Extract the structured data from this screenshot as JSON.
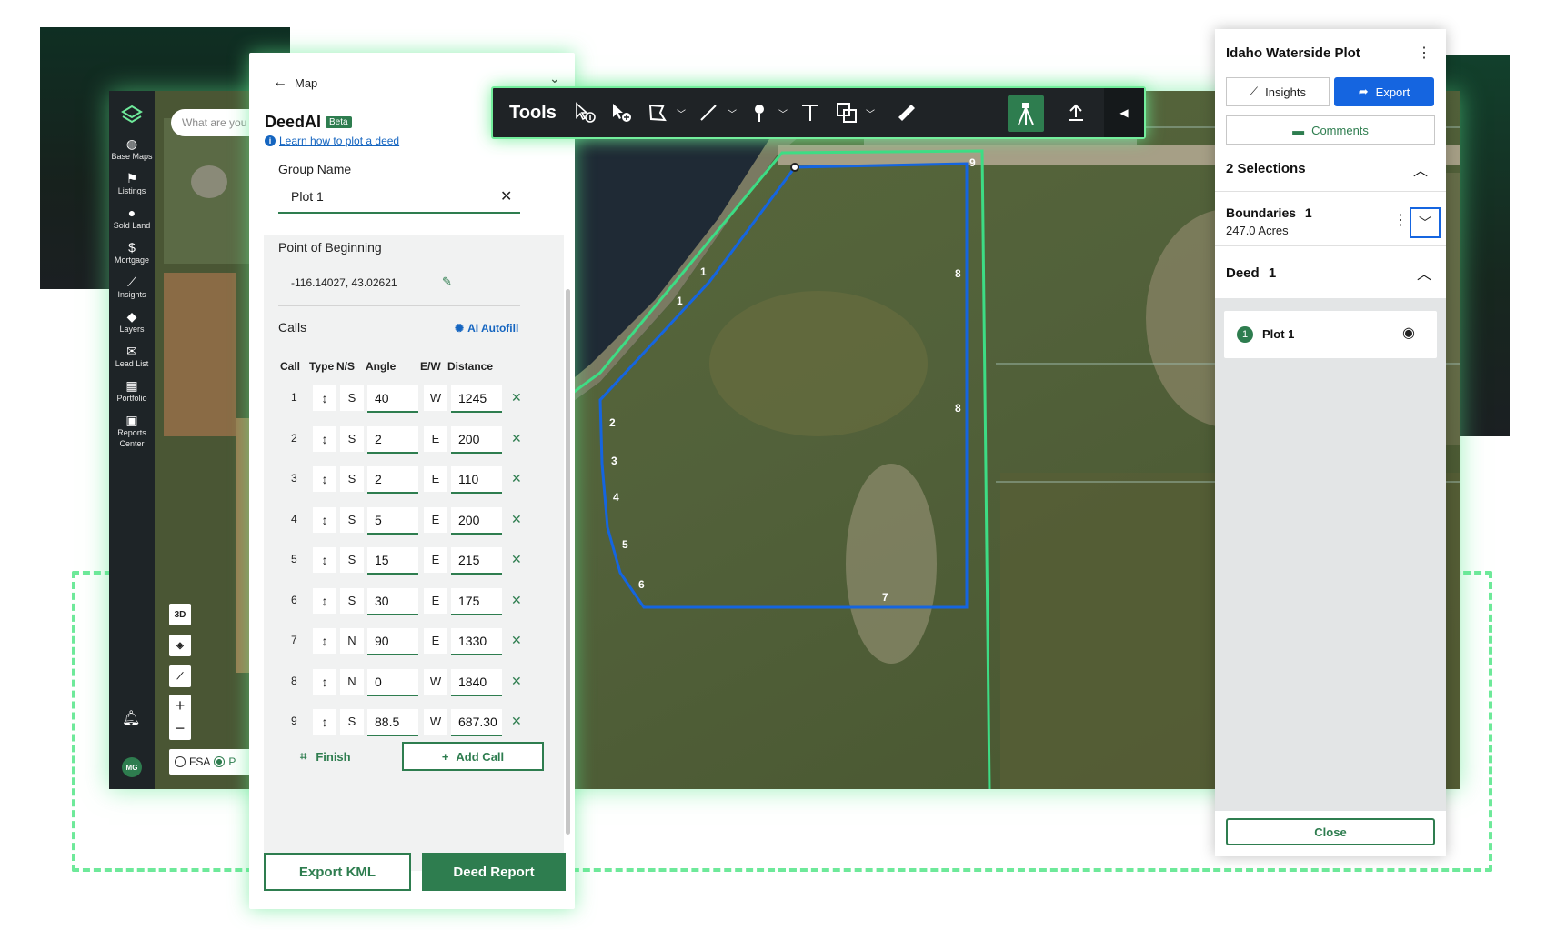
{
  "sidebar": {
    "items": [
      {
        "label": "Base Maps",
        "icon": "globe-icon"
      },
      {
        "label": "Listings",
        "icon": "flag-icon"
      },
      {
        "label": "Sold Land",
        "icon": "pin-icon"
      },
      {
        "label": "Mortgage",
        "icon": "dollar-icon"
      },
      {
        "label": "Insights",
        "icon": "insights-icon"
      },
      {
        "label": "Layers",
        "icon": "layers-icon"
      },
      {
        "label": "Lead List",
        "icon": "mail-icon"
      },
      {
        "label": "Portfolio",
        "icon": "map-icon"
      },
      {
        "label": "Reports Center",
        "icon": "briefcase-icon"
      }
    ],
    "avatar": "MG"
  },
  "search": {
    "placeholder": "What are you"
  },
  "map_controls": {
    "three_d": "3D",
    "zoom_in": "+",
    "zoom_out": "−",
    "fsa": "FSA",
    "second_option": "P"
  },
  "deed_panel": {
    "back_label": "Map",
    "title": "DeedAI",
    "badge": "Beta",
    "learn_link": "Learn how to plot a deed",
    "group_name_label": "Group Name",
    "group_name_value": "Plot 1",
    "pob_label": "Point of Beginning",
    "pob_value": "-116.14027, 43.02621",
    "calls_label": "Calls",
    "ai_autofill": "AI Autofill",
    "headers": {
      "call": "Call",
      "type": "Type",
      "ns": "N/S",
      "angle": "Angle",
      "ew": "E/W",
      "distance": "Distance"
    },
    "calls": [
      {
        "num": "1",
        "ns": "S",
        "angle": "40",
        "ew": "W",
        "distance": "1245"
      },
      {
        "num": "2",
        "ns": "S",
        "angle": "2",
        "ew": "E",
        "distance": "200"
      },
      {
        "num": "3",
        "ns": "S",
        "angle": "2",
        "ew": "E",
        "distance": "110"
      },
      {
        "num": "4",
        "ns": "S",
        "angle": "5",
        "ew": "E",
        "distance": "200"
      },
      {
        "num": "5",
        "ns": "S",
        "angle": "15",
        "ew": "E",
        "distance": "215"
      },
      {
        "num": "6",
        "ns": "S",
        "angle": "30",
        "ew": "E",
        "distance": "175"
      },
      {
        "num": "7",
        "ns": "N",
        "angle": "90",
        "ew": "E",
        "distance": "1330"
      },
      {
        "num": "8",
        "ns": "N",
        "angle": "0",
        "ew": "W",
        "distance": "1840"
      },
      {
        "num": "9",
        "ns": "S",
        "angle": "88.5",
        "ew": "W",
        "distance": "687.30"
      }
    ],
    "finish": "Finish",
    "add_call": "Add Call",
    "export_kml": "Export KML",
    "deed_report": "Deed Report"
  },
  "toolbar": {
    "label": "Tools"
  },
  "right_panel": {
    "title": "Idaho Waterside Plot",
    "insights": "Insights",
    "export": "Export",
    "comments": "Comments",
    "selections": "2 Selections",
    "boundaries_label": "Boundaries",
    "boundaries_count": "1",
    "boundaries_acres": "247.0 Acres",
    "deed_label": "Deed",
    "deed_count": "1",
    "plot_number": "1",
    "plot_name": "Plot 1",
    "close": "Close"
  },
  "map_labels": [
    "1",
    "1",
    "2",
    "3",
    "4",
    "5",
    "6",
    "7",
    "8",
    "8",
    "9"
  ],
  "colors": {
    "brand_green": "#2e7d4f",
    "glow_green": "#6ee99a",
    "boundary_blue": "#1565e0",
    "parcel_line": "#3ddc84"
  }
}
